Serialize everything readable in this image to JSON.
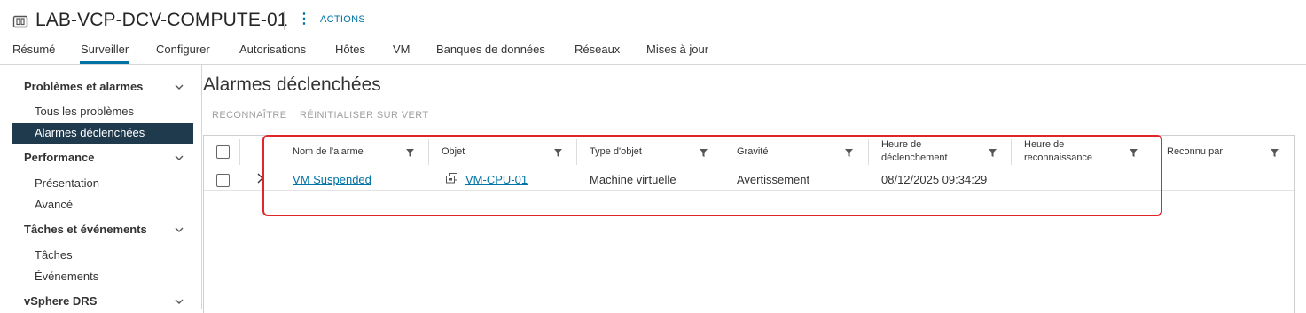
{
  "header": {
    "icon": "cluster-icon",
    "title": "LAB-VCP-DCV-COMPUTE-01",
    "actions_label": "ACTIONS"
  },
  "tabs": [
    {
      "label": "Résumé"
    },
    {
      "label": "Surveiller",
      "active": true
    },
    {
      "label": "Configurer"
    },
    {
      "label": "Autorisations"
    },
    {
      "label": "Hôtes"
    },
    {
      "label": "VM"
    },
    {
      "label": "Banques de données"
    },
    {
      "label": "Réseaux"
    },
    {
      "label": "Mises à jour"
    }
  ],
  "sidebar": {
    "sections": [
      {
        "label": "Problèmes et alarmes",
        "items": [
          {
            "label": "Tous les problèmes"
          },
          {
            "label": "Alarmes déclenchées",
            "active": true
          }
        ]
      },
      {
        "label": "Performance",
        "items": [
          {
            "label": "Présentation"
          },
          {
            "label": "Avancé"
          }
        ]
      },
      {
        "label": "Tâches et événements",
        "items": [
          {
            "label": "Tâches"
          },
          {
            "label": "Événements"
          }
        ]
      },
      {
        "label": "vSphere DRS",
        "items": []
      }
    ]
  },
  "main": {
    "title": "Alarmes déclenchées",
    "buttons": {
      "acknowledge": "RECONNAÎTRE",
      "reset": "RÉINITIALISER SUR VERT"
    },
    "columns": [
      {
        "label": "Nom de l'alarme"
      },
      {
        "label": "Objet"
      },
      {
        "label": "Type d'objet"
      },
      {
        "label": "Gravité"
      },
      {
        "label_line1": "Heure de",
        "label_line2": "déclenchement"
      },
      {
        "label_line1": "Heure de",
        "label_line2": "reconnaissance"
      },
      {
        "label": "Reconnu par"
      }
    ],
    "rows": [
      {
        "alarm_name": "VM Suspended",
        "object": "VM-CPU-01",
        "object_icon": "vm-icon",
        "object_type": "Machine virtuelle",
        "severity": "Avertissement",
        "triggered_time": "08/12/2025 09:34:29",
        "acknowledged_time": "",
        "acknowledged_by": ""
      }
    ]
  },
  "colors": {
    "accent": "#0072a3",
    "nav_active_bg": "#1f3a4d",
    "highlight_box": "#e0262b"
  }
}
